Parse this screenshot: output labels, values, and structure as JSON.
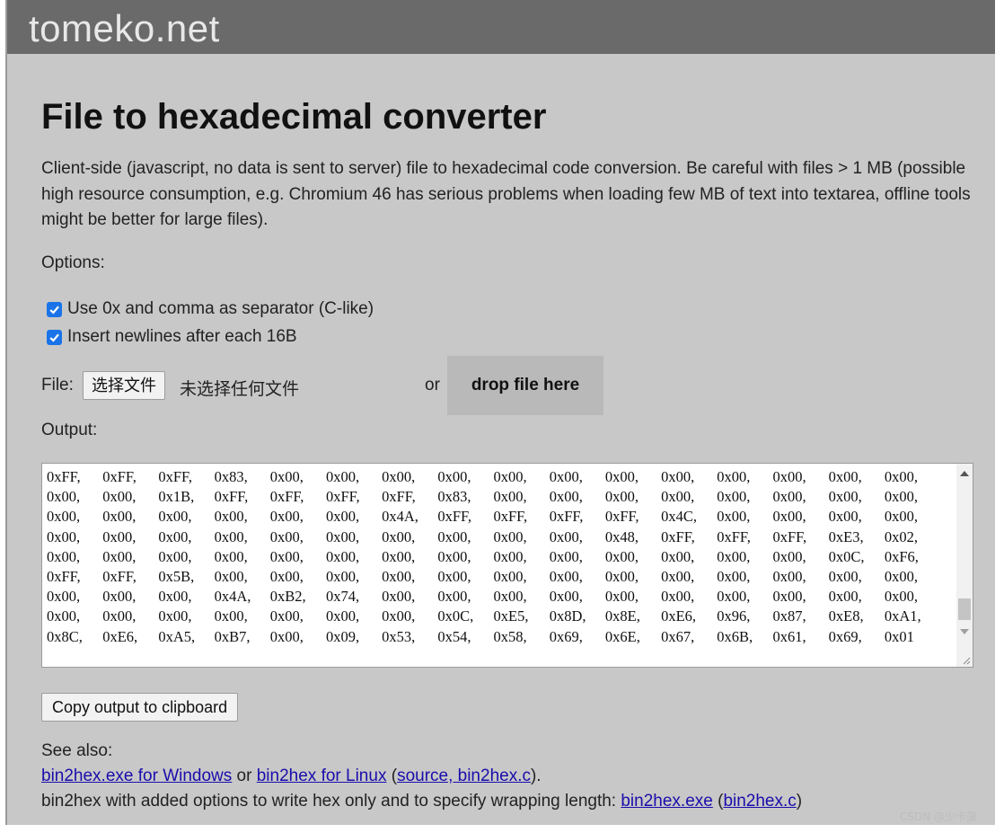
{
  "site": {
    "name": "tomeko.net"
  },
  "page": {
    "title": "File to hexadecimal converter",
    "intro": "Client-side (javascript, no data is sent to server) file to hexadecimal code conversion. Be careful with files > 1 MB (possible high resource consumption, e.g. Chromium 46 has serious problems when loading few MB of text into textarea, offline tools might be better for large files)."
  },
  "options": {
    "label": "Options:",
    "items": [
      {
        "label": "Use 0x and comma as separator (C-like)",
        "checked": true
      },
      {
        "label": "Insert newlines after each 16B",
        "checked": true
      }
    ]
  },
  "file": {
    "label": "File:",
    "choose_button": "选择文件",
    "no_file_text": "未选择任何文件",
    "or_text": "or",
    "drop_zone": "drop file here"
  },
  "output": {
    "label": "Output:",
    "lines": [
      [
        "0xFF,",
        "0xFF,",
        "0xFF,",
        "0x83,",
        "0x00,",
        "0x00,",
        "0x00,",
        "0x00,",
        "0x00,",
        "0x00,",
        "0x00,",
        "0x00,",
        "0x00,",
        "0x00,",
        "0x00,",
        "0x00,"
      ],
      [
        "0x00,",
        "0x00,",
        "0x1B,",
        "0xFF,",
        "0xFF,",
        "0xFF,",
        "0xFF,",
        "0x83,",
        "0x00,",
        "0x00,",
        "0x00,",
        "0x00,",
        "0x00,",
        "0x00,",
        "0x00,",
        "0x00,"
      ],
      [
        "0x00,",
        "0x00,",
        "0x00,",
        "0x00,",
        "0x00,",
        "0x00,",
        "0x4A,",
        "0xFF,",
        "0xFF,",
        "0xFF,",
        "0xFF,",
        "0x4C,",
        "0x00,",
        "0x00,",
        "0x00,",
        "0x00,"
      ],
      [
        "0x00,",
        "0x00,",
        "0x00,",
        "0x00,",
        "0x00,",
        "0x00,",
        "0x00,",
        "0x00,",
        "0x00,",
        "0x00,",
        "0x48,",
        "0xFF,",
        "0xFF,",
        "0xFF,",
        "0xE3,",
        "0x02,"
      ],
      [
        "0x00,",
        "0x00,",
        "0x00,",
        "0x00,",
        "0x00,",
        "0x00,",
        "0x00,",
        "0x00,",
        "0x00,",
        "0x00,",
        "0x00,",
        "0x00,",
        "0x00,",
        "0x00,",
        "0x0C,",
        "0xF6,"
      ],
      [
        "0xFF,",
        "0xFF,",
        "0x5B,",
        "0x00,",
        "0x00,",
        "0x00,",
        "0x00,",
        "0x00,",
        "0x00,",
        "0x00,",
        "0x00,",
        "0x00,",
        "0x00,",
        "0x00,",
        "0x00,",
        "0x00,"
      ],
      [
        "0x00,",
        "0x00,",
        "0x00,",
        "0x4A,",
        "0xB2,",
        "0x74,",
        "0x00,",
        "0x00,",
        "0x00,",
        "0x00,",
        "0x00,",
        "0x00,",
        "0x00,",
        "0x00,",
        "0x00,",
        "0x00,"
      ],
      [
        "0x00,",
        "0x00,",
        "0x00,",
        "0x00,",
        "0x00,",
        "0x00,",
        "0x00,",
        "0x0C,",
        "0xE5,",
        "0x8D,",
        "0x8E,",
        "0xE6,",
        "0x96,",
        "0x87,",
        "0xE8,",
        "0xA1,"
      ],
      [
        "0x8C,",
        "0xE6,",
        "0xA5,",
        "0xB7,",
        "0x00,",
        "0x09,",
        "0x53,",
        "0x54,",
        "0x58,",
        "0x69,",
        "0x6E,",
        "0x67,",
        "0x6B,",
        "0x61,",
        "0x69,",
        "0x01"
      ]
    ]
  },
  "copy_button": "Copy output to clipboard",
  "see_also": {
    "label": "See also:",
    "line1": {
      "link1": "bin2hex.exe for Windows",
      "text1": " or ",
      "link2": "bin2hex for Linux",
      "text2": " (",
      "link3": "source, bin2hex.c",
      "text3": ")."
    },
    "line2": {
      "text1": "bin2hex with added options to write hex only and to specify wrapping length: ",
      "link1": "bin2hex.exe",
      "text2": " (",
      "link2": "bin2hex.c",
      "text3": ")"
    }
  },
  "watermark": "CSDN @少卡菠",
  "colors": {
    "header": "#6a6a6a",
    "background": "#c8c8c8",
    "link": "#1a0dab",
    "checkbox": "#1a73e8"
  }
}
